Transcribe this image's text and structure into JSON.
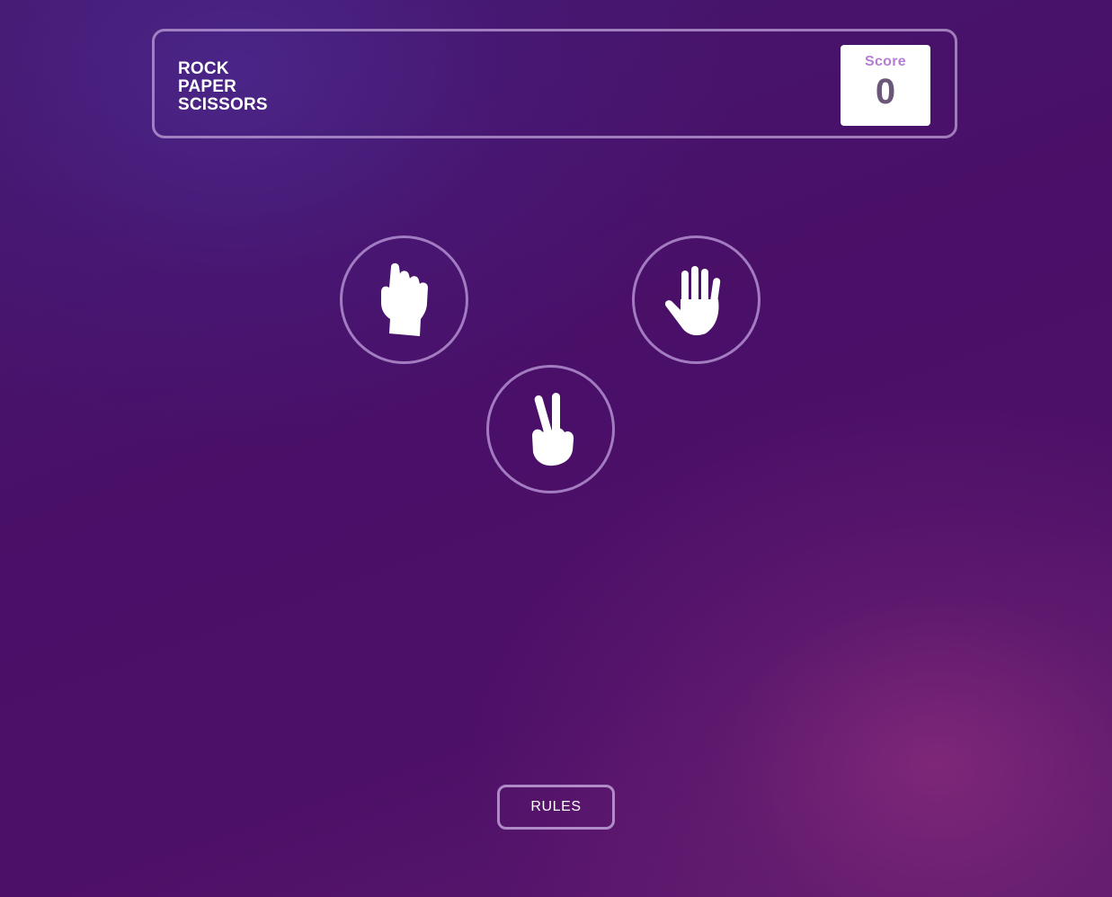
{
  "header": {
    "title_lines": [
      "ROCK",
      "PAPER",
      "SCISSORS"
    ],
    "score_label": "Score",
    "score_value": "0"
  },
  "choices": [
    {
      "id": "rock",
      "icon": "fist-icon"
    },
    {
      "id": "paper",
      "icon": "open-hand-icon"
    },
    {
      "id": "scissors",
      "icon": "peace-sign-icon"
    }
  ],
  "footer": {
    "rules_label": "RULES"
  },
  "colors": {
    "background": "#4a0f68",
    "accent": "#b47cd6",
    "score_text": "#6b5878",
    "border": "#be a0d7"
  }
}
